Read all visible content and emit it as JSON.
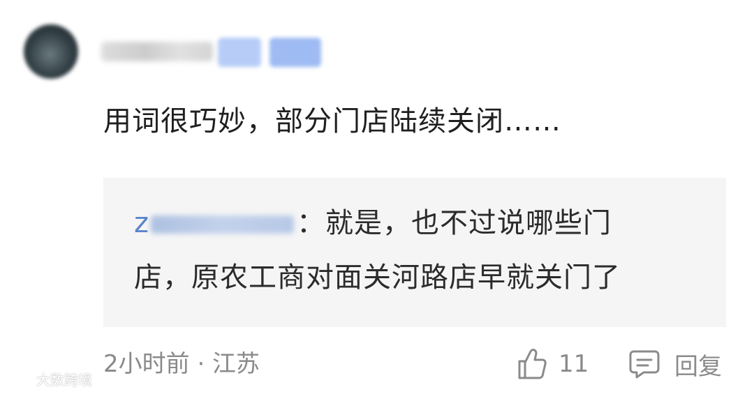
{
  "comment": {
    "text": "用词很巧妙，部分门店陆续关闭……"
  },
  "reply": {
    "user_initial": "z",
    "line1_text": "：就是，也不过说哪些门",
    "line2_text": "店，原农工商对面关河路店早就关门了"
  },
  "meta": {
    "time_location": "2小时前 · 江苏"
  },
  "actions": {
    "like_count": "11",
    "reply_label": "回复",
    "like_icon": "thumbs-up-icon",
    "reply_icon": "comment-bubble-icon"
  },
  "watermark": {
    "text": "大数跨境"
  },
  "colors": {
    "text_primary": "#1f1f1f",
    "text_secondary": "#8a8a8a",
    "link_blue": "#5a85c9",
    "reply_bg": "#f5f5f5"
  }
}
